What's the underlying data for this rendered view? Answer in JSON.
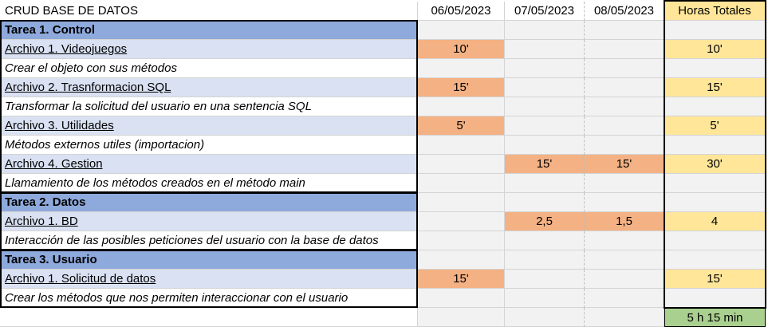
{
  "header": {
    "title": "CRUD BASE DE DATOS",
    "dates": [
      "06/05/2023",
      "07/05/2023",
      "08/05/2023"
    ],
    "total_label": "Horas Totales"
  },
  "tasks": [
    {
      "title": "Tarea 1. Control",
      "files": [
        {
          "name": "Archivo 1. Videojuegos",
          "description": "Crear el objeto con sus métodos",
          "hours": [
            "10'",
            "",
            ""
          ],
          "total": "10'"
        },
        {
          "name": "Archivo 2. Trasnformacion SQL",
          "description": "Transformar la solicitud del usuario en una sentencia SQL",
          "hours": [
            "15'",
            "",
            ""
          ],
          "total": "15'"
        },
        {
          "name": "Archivo 3. Utilidades",
          "description": "Métodos externos utiles (importacion)",
          "hours": [
            "5'",
            "",
            ""
          ],
          "total": "5'"
        },
        {
          "name": "Archivo 4. Gestion",
          "description": "Llamamiento de los métodos creados en el método main",
          "hours": [
            "",
            "15'",
            "15'"
          ],
          "total": "30'"
        }
      ]
    },
    {
      "title": "Tarea 2. Datos",
      "files": [
        {
          "name": "Archivo 1. BD",
          "description": "Interacción de las posibles peticiones del usuario con la base de datos",
          "hours": [
            "",
            "2,5",
            "1,5"
          ],
          "total": "4"
        }
      ]
    },
    {
      "title": "Tarea 3. Usuario",
      "files": [
        {
          "name": "Archivo 1. Solicitud de datos",
          "description": "Crear los métodos que nos permiten interaccionar con el usuario",
          "hours": [
            "15'",
            "",
            ""
          ],
          "total": "15'"
        }
      ]
    }
  ],
  "grand_total": "5 h 15 min",
  "colors": {
    "task_header": "#8ea9db",
    "file_row": "#d9e1f2",
    "hours_cell": "#f4b183",
    "total_cell": "#ffe699",
    "grand_total": "#a9d08e",
    "empty_cell": "#f2f2f2"
  }
}
